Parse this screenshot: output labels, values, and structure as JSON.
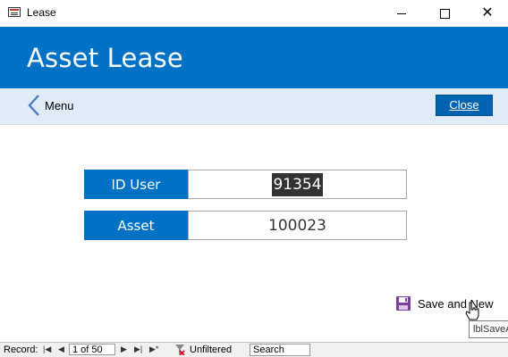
{
  "window": {
    "title": "Lease",
    "controls": {
      "minimize": "minimize-icon",
      "maximize": "maximize-icon",
      "close": "close-icon"
    }
  },
  "header": {
    "title": "Asset Lease"
  },
  "nav": {
    "back_label": "Menu",
    "close_label": "Close"
  },
  "form": {
    "fields": [
      {
        "label": "ID User",
        "value": "91354",
        "selected": true
      },
      {
        "label": "Asset",
        "value": "100023",
        "selected": false
      }
    ],
    "save_new_label": "Save and New"
  },
  "tooltip": {
    "text": "lblSaveA"
  },
  "record_nav": {
    "label": "Record:",
    "first": "|◀",
    "prev": "◀",
    "position": "1 of 50",
    "next": "▶",
    "last": "▶|",
    "new": "▶*",
    "filter_label": "Unfiltered",
    "search_placeholder": "Search"
  },
  "colors": {
    "header_bg": "#0072c6",
    "nav_bg": "#e0ebf8",
    "label_bg": "#0072c6",
    "close_button_bg": "#0063b1"
  }
}
